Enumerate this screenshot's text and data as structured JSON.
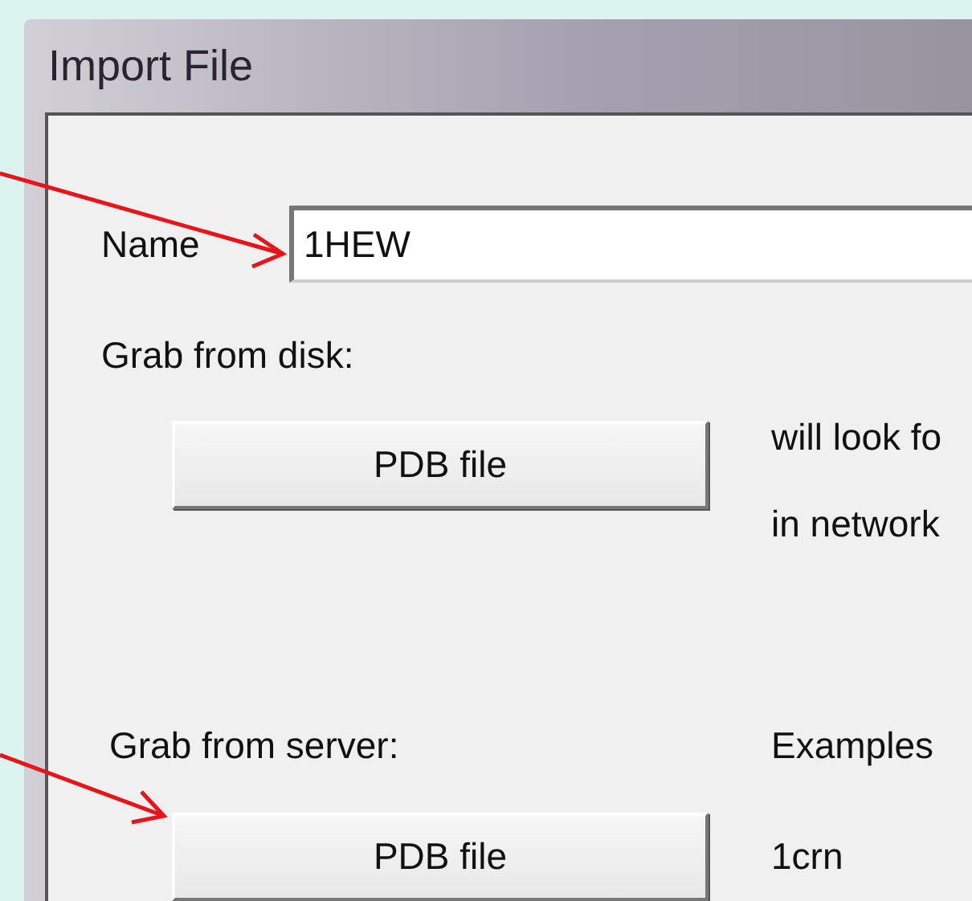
{
  "window": {
    "title": "Import File"
  },
  "name_field": {
    "label": "Name",
    "value": "1HEW"
  },
  "disk": {
    "label": "Grab from disk:",
    "button": "PDB file",
    "note_lines": [
      "will look fo",
      "in network"
    ]
  },
  "server": {
    "label": "Grab from server:",
    "button": "PDB file",
    "examples_label": "Examples",
    "example": "1crn"
  }
}
